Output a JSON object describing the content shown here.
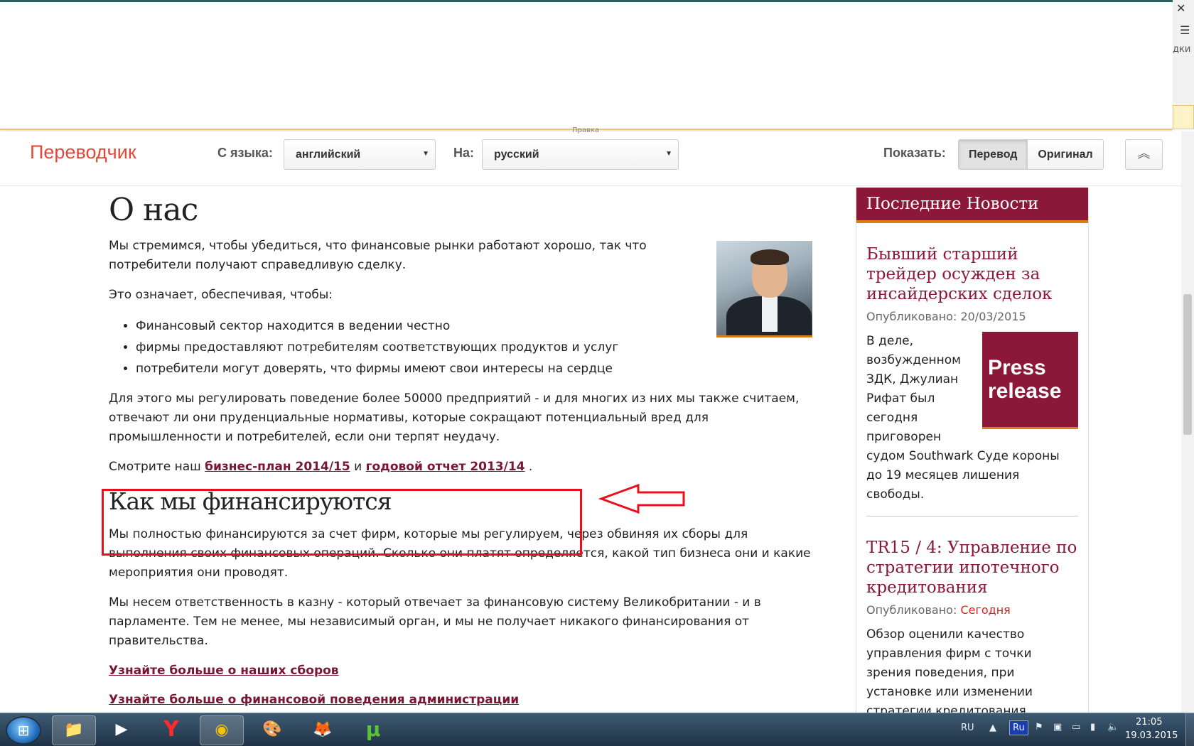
{
  "window": {
    "close_glyph": "✕",
    "menu_glyph": "☰",
    "bookmarks_fragment": "дки",
    "tiny_text": "Правка"
  },
  "translator": {
    "title": "Переводчик",
    "from_label": "С языка:",
    "from_value": "английский",
    "to_label": "На:",
    "to_value": "русский",
    "show_label": "Показать:",
    "btn_translation": "Перевод",
    "btn_original": "Оригинал",
    "collapse_icon": "chevrons-up-icon"
  },
  "page": {
    "heading": "О нас",
    "intro": "Мы стремимся, чтобы убедиться, что финансовые рынки работают хорошо, так что потребители получают справедливую сделку.",
    "means": "Это означает, обеспечивая, чтобы:",
    "bullets": [
      "Финансовый сектор находится в ведении честно",
      "фирмы предоставляют потребителям соответствующих продуктов и услуг",
      "потребители могут доверять, что фирмы имеют свои интересы на сердце"
    ],
    "regulate": "Для этого мы регулировать поведение более 50000 предприятий - и для многих из них мы также считаем, отвечают ли они пруденциальные нормативы, которые сокращают потенциальный вред для промышленности и потребителей, если они терпят неудачу.",
    "see_prefix": "Смотрите наш",
    "link_business_plan": "бизнес-план 2014/15",
    "see_and": "и",
    "link_annual_report": "годовой отчет 2013/14",
    "see_suffix": ".",
    "funding_heading": "Как мы финансируются",
    "funding_text": "Мы полностью финансируются за счет фирм, которые мы регулируем, через обвиняя их сборы для выполнения своих финансовых операций. Сколько они платят определяется, какой тип бизнеса они и какие мероприятия они проводят.",
    "accountable_text": "Мы несем ответственность в казну - который отвечает за финансовую систему Великобритании - и в парламенте. Тем не менее, мы независимый орган, и мы не получает никакого финансирования от правительства.",
    "link_fees": "Узнайте больше о наших сборов",
    "link_admin": "Узнайте больше о финансовой поведения администрации"
  },
  "sidebar": {
    "heading": "Последние Новости",
    "news": [
      {
        "title": "Бывший старший трейдер осужден за инсайдерских сделок",
        "meta_label": "Опубликовано:",
        "date": "20/03/2015",
        "body": "В деле, возбужденном ЗДК, Джулиан Рифат был сегодня приговорен судом Southwark Суде короны до 19 месяцев лишения свободы.",
        "badge_line1": "Press",
        "badge_line2": "release"
      },
      {
        "title": "TR15 / 4: Управление по стратегии ипотечного кредитования",
        "meta_label": "Опубликовано:",
        "date": "Сегодня",
        "body": "Обзор оценили качество управления фирм с точки зрения поведения, при установке или изменении стратегии кредитования."
      }
    ]
  },
  "taskbar": {
    "start_icon": "windows-start-icon",
    "apps": [
      {
        "name": "explorer",
        "glyph": "📁"
      },
      {
        "name": "media-player",
        "glyph": "▶"
      },
      {
        "name": "yandex",
        "glyph": "Y"
      },
      {
        "name": "chrome",
        "glyph": "◉"
      },
      {
        "name": "paint",
        "glyph": "🎨"
      },
      {
        "name": "firefox",
        "glyph": "🦊"
      },
      {
        "name": "utorrent",
        "glyph": "µ"
      }
    ],
    "lang": "RU",
    "kb_layout": "Ru",
    "time": "21:05",
    "date": "19.03.2015"
  },
  "colors": {
    "brand": "#8b1838",
    "accent_orange": "#e07b18",
    "translator_red": "#e0493a",
    "annotation_red": "#e8101c"
  }
}
